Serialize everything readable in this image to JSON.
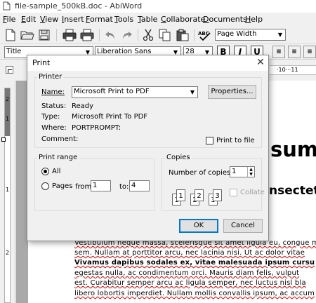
{
  "window": {
    "title": "file-sample_500kB.doc - AbiWord"
  },
  "menu": [
    "File",
    "Edit",
    "View",
    "Insert",
    "Format",
    "Tools",
    "Table",
    "Collaborate",
    "Documents",
    "Help"
  ],
  "toolbar": {
    "zoom_value": "Page Width"
  },
  "format_bar": {
    "style": "Title",
    "font": "Liberation Sans",
    "size": "28"
  },
  "ruler": {
    "label": "·10···11"
  },
  "vruler_numbers": [
    "2",
    "1",
    "1",
    "2"
  ],
  "document": {
    "heading1": "sum",
    "heading2": "nsectetu",
    "lines": [
      "Vestibulum neque massa, scelerisque sit amet ligula eu, congue m",
      "sem. Nullam at porttitor arcu, nec lacinia nisi. Ut ac dolor vitae",
      "Vivamus dapibus sodales ex, vitae malesuada ipsum cursu",
      "egestas nulla, ac condimentum orci. Mauris diam felis, vulput",
      "est. Curabitur semper arcu ac ligula semper, nec luctus nisl bla",
      "libero lobortis imperdiet. Nullam mollis convallis ipsum, ac accum"
    ]
  },
  "dialog": {
    "title": "Print",
    "printer_group": "Printer",
    "name_label": "Name:",
    "printer_name": "Microsoft Print to PDF",
    "properties_label": "Properties...",
    "status_label": "Status:",
    "status_value": "Ready",
    "type_label": "Type:",
    "type_value": "Microsoft Print To PDF",
    "where_label": "Where:",
    "where_value": "PORTPROMPT:",
    "comment_label": "Comment:",
    "print_to_file_label": "Print to file",
    "print_range_group": "Print range",
    "all_label": "All",
    "pages_label": "Pages",
    "from_label": "from:",
    "from_value": "1",
    "to_label": "to:",
    "to_value": "4",
    "copies_group": "Copies",
    "number_of_copies_label": "Number of copies:",
    "copies_value": "1",
    "collate_label": "Collate",
    "ok_label": "OK",
    "cancel_label": "Cancel"
  }
}
